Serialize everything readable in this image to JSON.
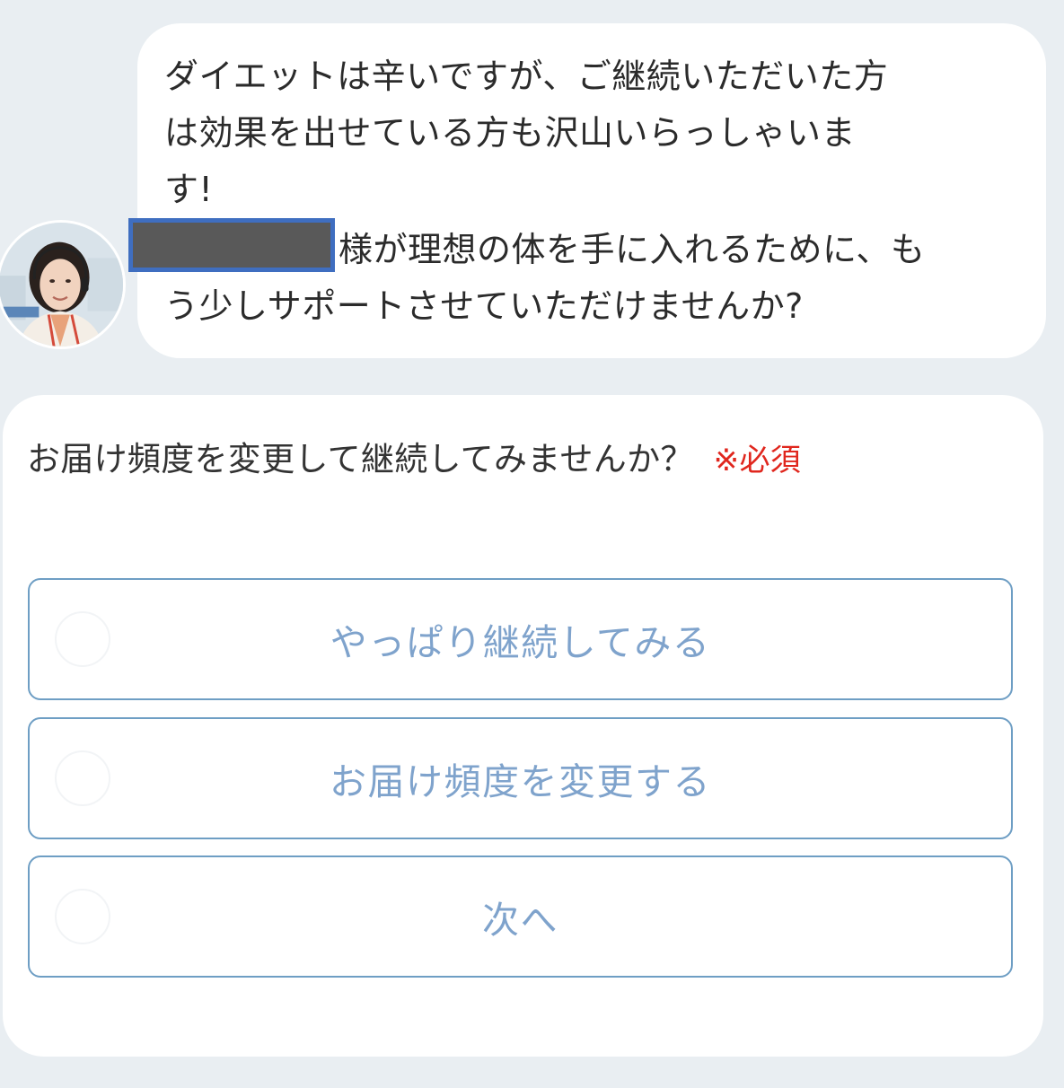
{
  "message": {
    "lines": [
      "ダイエットは辛いですが、ご継続いただいた方",
      "は効果を出せている方も沢山いらっしゃいま",
      "す!",
      "様が理想の体を手に入れるために、も",
      "う少しサポートさせていただけませんか?"
    ]
  },
  "question": {
    "text": "お届け頻度を変更して継続してみませんか？",
    "required": "※必須"
  },
  "options": [
    {
      "label": "やっぱり継続してみる"
    },
    {
      "label": "お届け頻度を変更する"
    },
    {
      "label": "次へ"
    }
  ],
  "colors": {
    "background": "#e9eef2",
    "required": "#e0271e",
    "option_border": "#6e9ec4",
    "option_text": "#7fa3cc",
    "redaction_fill": "#595959",
    "redaction_border": "#3f6ec0"
  }
}
